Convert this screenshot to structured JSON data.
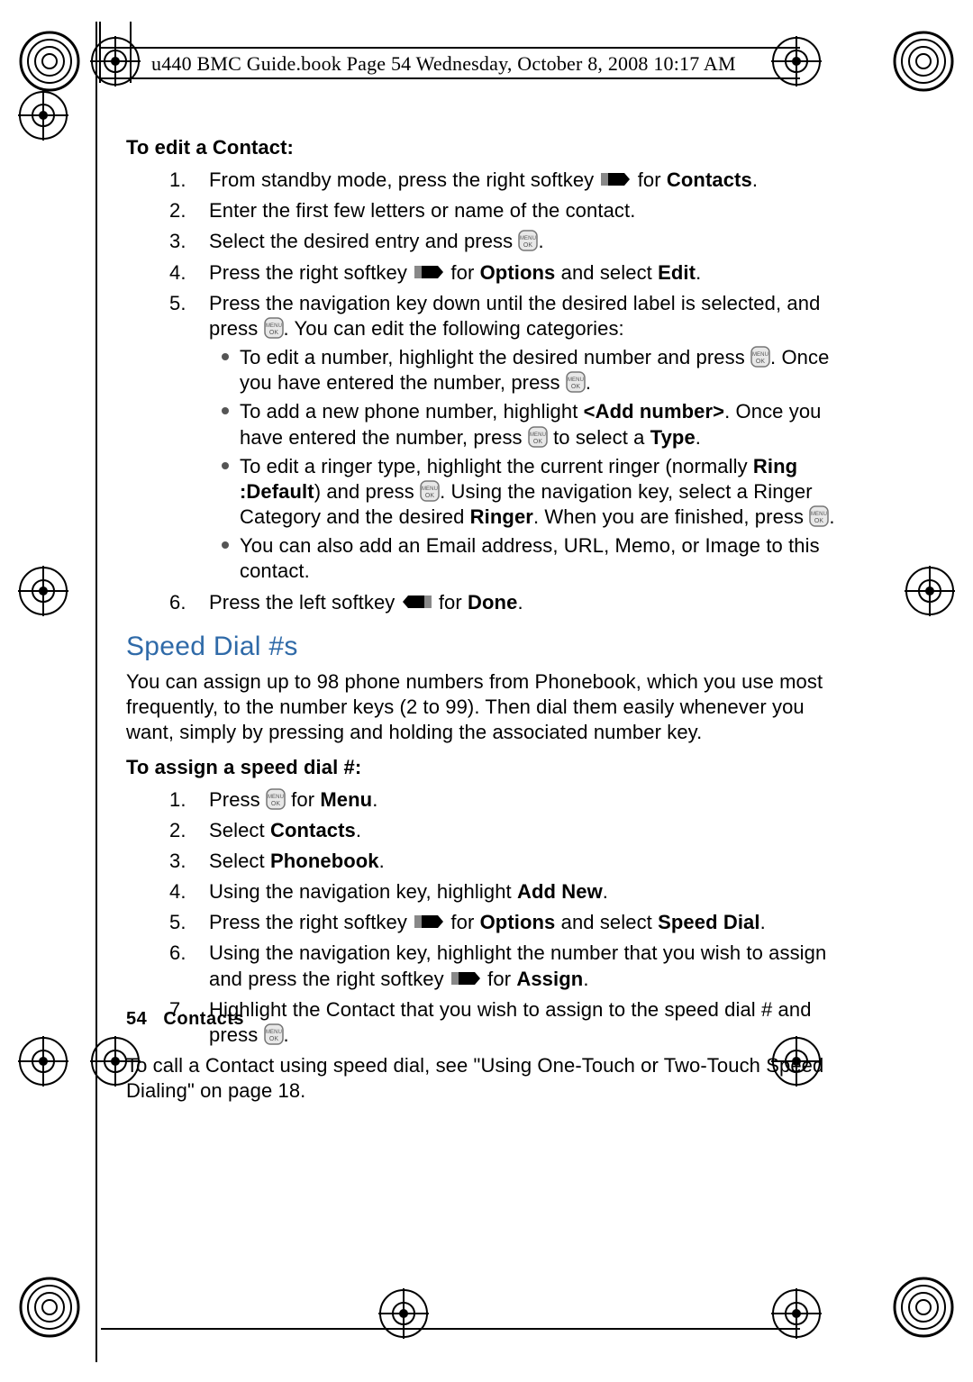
{
  "header_line": "u440 BMC Guide.book  Page 54  Wednesday, October 8, 2008  10:17 AM",
  "s1_head": "To edit a Contact:",
  "s1_1a": "From standby mode, press the right softkey ",
  "s1_1b": " for ",
  "s1_1c": "Contacts",
  "s1_1d": ".",
  "s1_2": "Enter the first few letters or name of the contact.",
  "s1_3a": "Select the desired entry and press ",
  "s1_3b": ".",
  "s1_4a": "Press the right softkey ",
  "s1_4b": " for ",
  "s1_4c": "Options",
  "s1_4d": " and select ",
  "s1_4e": "Edit",
  "s1_4f": ".",
  "s1_5a": "Press the navigation key down until the desired label is selected, and press ",
  "s1_5b": ". You can edit the following categories:",
  "b1a": "To edit a number, highlight the desired number and press ",
  "b1b": ". Once you have entered the number, press ",
  "b1c": ".",
  "b2a": "To add a new phone number, highlight ",
  "b2b": "<Add number>",
  "b2c": ". Once you have entered the number, press ",
  "b2d": " to select a ",
  "b2e": "Type",
  "b2f": ".",
  "b3a": "To edit a ringer type, highlight the current ringer (normally ",
  "b3b": "Ring :Default",
  "b3c": ") and press ",
  "b3d": ". Using the navigation key, select a Ringer Category and the desired ",
  "b3e": "Ringer",
  "b3f": ". When you are finished, press ",
  "b3g": ".",
  "b4": "You can also add an Email address, URL, Memo, or Image to this contact.",
  "s1_6a": "Press the left softkey ",
  "s1_6b": " for ",
  "s1_6c": "Done",
  "s1_6d": ".",
  "section_title": "Speed Dial #s",
  "sd_para": "You can assign up to 98 phone numbers from Phonebook, which you use most frequently, to the number keys (2 to 99). Then dial them easily whenever you want, simply by pressing and holding the associated number key.",
  "s2_head": "To assign a speed dial #:",
  "s2_1a": "Press ",
  "s2_1b": " for ",
  "s2_1c": "Menu",
  "s2_1d": ".",
  "s2_2a": "Select ",
  "s2_2b": "Contacts",
  "s2_2c": ".",
  "s2_3a": "Select ",
  "s2_3b": "Phonebook",
  "s2_3c": ".",
  "s2_4a": "Using the navigation key, highlight ",
  "s2_4b": "Add New",
  "s2_4c": ".",
  "s2_5a": "Press the right softkey ",
  "s2_5b": " for ",
  "s2_5c": "Options",
  "s2_5d": " and select ",
  "s2_5e": "Speed Dial",
  "s2_5f": ".",
  "s2_6a": "Using the navigation key, highlight the number that you wish to assign and press the right softkey ",
  "s2_6b": " for ",
  "s2_6c": "Assign",
  "s2_6d": ".",
  "s2_7a": "Highlight the Contact that you wish to assign to the speed dial # and press ",
  "s2_7b": ".",
  "closing": "To call a Contact using speed dial, see \"Using One-Touch or Two-Touch Speed Dialing\" on page 18.",
  "footer_pg": "54",
  "footer_section": "Contacts"
}
